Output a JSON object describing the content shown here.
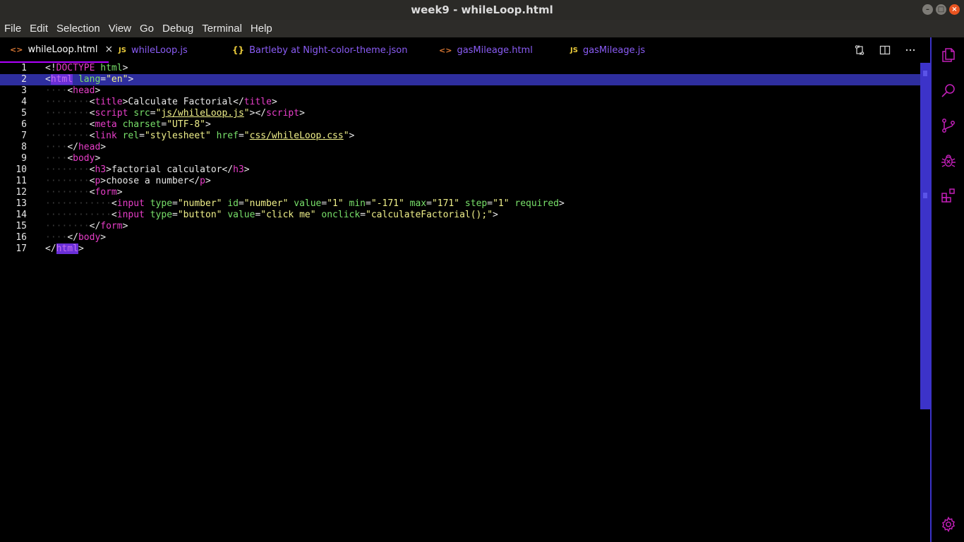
{
  "window": {
    "title": "week9 - whileLoop.html"
  },
  "menu": [
    "File",
    "Edit",
    "Selection",
    "View",
    "Go",
    "Debug",
    "Terminal",
    "Help"
  ],
  "tabs": [
    {
      "icon": "<>",
      "type": "html",
      "label": "whileLoop.html",
      "active": true,
      "close": "×"
    },
    {
      "icon": "JS",
      "type": "js",
      "label": "whileLoop.js"
    },
    {
      "icon": "{}",
      "type": "json",
      "label": "Bartleby at Night-color-theme.json"
    },
    {
      "icon": "<>",
      "type": "html",
      "label": "gasMileage.html"
    },
    {
      "icon": "JS",
      "type": "js",
      "label": "gasMileage.js"
    }
  ],
  "editor": {
    "highlighted_line": 2,
    "lines": [
      {
        "n": "1",
        "indent": "",
        "tokens": [
          [
            "p",
            "<!"
          ],
          [
            "t",
            "DOCTYPE"
          ],
          [
            "p",
            " "
          ],
          [
            "a",
            "html"
          ],
          [
            "p",
            ">"
          ]
        ]
      },
      {
        "n": "2",
        "indent": "",
        "tokens": [
          [
            "p",
            "<"
          ],
          [
            "tagsel",
            "html"
          ],
          [
            "p",
            " "
          ],
          [
            "a",
            "lang"
          ],
          [
            "p",
            "="
          ],
          [
            "s",
            "\"en\""
          ],
          [
            "p",
            ">"
          ]
        ]
      },
      {
        "n": "3",
        "indent": "····",
        "tokens": [
          [
            "p",
            "<"
          ],
          [
            "t",
            "head"
          ],
          [
            "p",
            ">"
          ]
        ]
      },
      {
        "n": "4",
        "indent": "········",
        "tokens": [
          [
            "p",
            "<"
          ],
          [
            "t",
            "title"
          ],
          [
            "p",
            ">"
          ],
          [
            "txt",
            "Calculate Factorial"
          ],
          [
            "p",
            "</"
          ],
          [
            "t",
            "title"
          ],
          [
            "p",
            ">"
          ]
        ]
      },
      {
        "n": "5",
        "indent": "········",
        "tokens": [
          [
            "p",
            "<"
          ],
          [
            "t",
            "script"
          ],
          [
            "p",
            " "
          ],
          [
            "a",
            "src"
          ],
          [
            "p",
            "="
          ],
          [
            "s",
            "\""
          ],
          [
            "u",
            "js/whileLoop.js"
          ],
          [
            "s",
            "\""
          ],
          [
            "p",
            "></"
          ],
          [
            "t",
            "script"
          ],
          [
            "p",
            ">"
          ]
        ]
      },
      {
        "n": "6",
        "indent": "········",
        "tokens": [
          [
            "p",
            "<"
          ],
          [
            "t",
            "meta"
          ],
          [
            "p",
            " "
          ],
          [
            "a",
            "charset"
          ],
          [
            "p",
            "="
          ],
          [
            "s",
            "\"UTF-8\""
          ],
          [
            "p",
            ">"
          ]
        ]
      },
      {
        "n": "7",
        "indent": "········",
        "tokens": [
          [
            "p",
            "<"
          ],
          [
            "t",
            "link"
          ],
          [
            "p",
            " "
          ],
          [
            "a",
            "rel"
          ],
          [
            "p",
            "="
          ],
          [
            "s",
            "\"stylesheet\""
          ],
          [
            "p",
            " "
          ],
          [
            "a",
            "href"
          ],
          [
            "p",
            "="
          ],
          [
            "s",
            "\""
          ],
          [
            "u",
            "css/whileLoop.css"
          ],
          [
            "s",
            "\""
          ],
          [
            "p",
            ">"
          ]
        ]
      },
      {
        "n": "8",
        "indent": "····",
        "tokens": [
          [
            "p",
            "</"
          ],
          [
            "t",
            "head"
          ],
          [
            "p",
            ">"
          ]
        ]
      },
      {
        "n": "9",
        "indent": "····",
        "tokens": [
          [
            "p",
            "<"
          ],
          [
            "t",
            "body"
          ],
          [
            "p",
            ">"
          ]
        ]
      },
      {
        "n": "10",
        "indent": "········",
        "tokens": [
          [
            "p",
            "<"
          ],
          [
            "t",
            "h3"
          ],
          [
            "p",
            ">"
          ],
          [
            "txt",
            "factorial calculator"
          ],
          [
            "p",
            "</"
          ],
          [
            "t",
            "h3"
          ],
          [
            "p",
            ">"
          ]
        ]
      },
      {
        "n": "11",
        "indent": "········",
        "tokens": [
          [
            "p",
            "<"
          ],
          [
            "t",
            "p"
          ],
          [
            "p",
            ">"
          ],
          [
            "txt",
            "choose a number"
          ],
          [
            "p",
            "</"
          ],
          [
            "t",
            "p"
          ],
          [
            "p",
            ">"
          ]
        ]
      },
      {
        "n": "12",
        "indent": "········",
        "tokens": [
          [
            "p",
            "<"
          ],
          [
            "t",
            "form"
          ],
          [
            "p",
            ">"
          ]
        ]
      },
      {
        "n": "13",
        "indent": "············",
        "tokens": [
          [
            "p",
            "<"
          ],
          [
            "t",
            "input"
          ],
          [
            "p",
            " "
          ],
          [
            "a",
            "type"
          ],
          [
            "p",
            "="
          ],
          [
            "s",
            "\"number\""
          ],
          [
            "p",
            " "
          ],
          [
            "a",
            "id"
          ],
          [
            "p",
            "="
          ],
          [
            "s",
            "\"number\""
          ],
          [
            "p",
            " "
          ],
          [
            "a",
            "value"
          ],
          [
            "p",
            "="
          ],
          [
            "s",
            "\"1\""
          ],
          [
            "p",
            " "
          ],
          [
            "a",
            "min"
          ],
          [
            "p",
            "="
          ],
          [
            "s",
            "\"-171\""
          ],
          [
            "p",
            " "
          ],
          [
            "a",
            "max"
          ],
          [
            "p",
            "="
          ],
          [
            "s",
            "\"171\""
          ],
          [
            "p",
            " "
          ],
          [
            "a",
            "step"
          ],
          [
            "p",
            "="
          ],
          [
            "s",
            "\"1\""
          ],
          [
            "p",
            " "
          ],
          [
            "a",
            "required"
          ],
          [
            "p",
            ">"
          ]
        ]
      },
      {
        "n": "14",
        "indent": "············",
        "tokens": [
          [
            "p",
            "<"
          ],
          [
            "t",
            "input"
          ],
          [
            "p",
            " "
          ],
          [
            "a",
            "type"
          ],
          [
            "p",
            "="
          ],
          [
            "s",
            "\"button\""
          ],
          [
            "p",
            " "
          ],
          [
            "a",
            "value"
          ],
          [
            "p",
            "="
          ],
          [
            "s",
            "\"click me\""
          ],
          [
            "p",
            " "
          ],
          [
            "a",
            "onclick"
          ],
          [
            "p",
            "="
          ],
          [
            "s",
            "\"calculateFactorial();\""
          ],
          [
            "p",
            ">"
          ]
        ]
      },
      {
        "n": "15",
        "indent": "········",
        "tokens": [
          [
            "p",
            "</"
          ],
          [
            "t",
            "form"
          ],
          [
            "p",
            ">"
          ]
        ]
      },
      {
        "n": "16",
        "indent": "····",
        "tokens": [
          [
            "p",
            "</"
          ],
          [
            "t",
            "body"
          ],
          [
            "p",
            ">"
          ]
        ]
      },
      {
        "n": "17",
        "indent": "",
        "tokens": [
          [
            "p",
            "</"
          ],
          [
            "tagsel",
            "html"
          ],
          [
            "p",
            ">"
          ]
        ]
      }
    ]
  },
  "activity_bar": [
    "explorer-icon",
    "search-icon",
    "source-control-icon",
    "debug-icon",
    "extensions-icon",
    "settings-gear-icon"
  ],
  "colors": {
    "accent": "#b000ff",
    "scrollbar": "#3c33c9",
    "line_highlight": "#2e2e9e",
    "tag": "#e83ec9",
    "attr": "#78e06a",
    "string": "#f0f08a",
    "tab_inactive": "#8a5cf5"
  }
}
